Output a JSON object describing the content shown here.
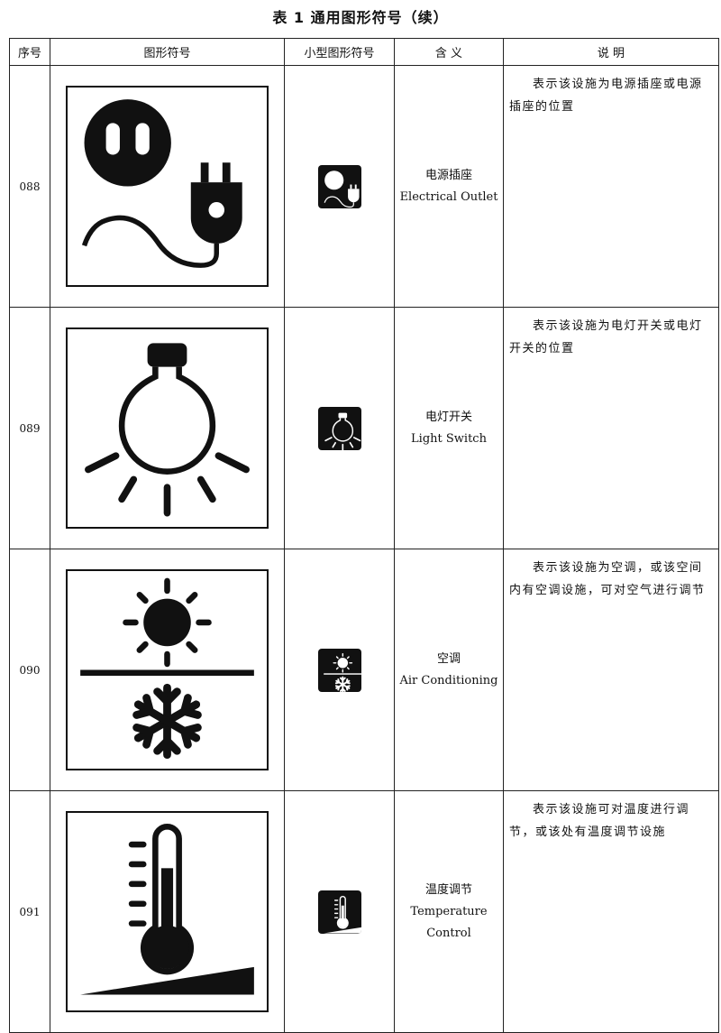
{
  "title": "表 1  通用图形符号（续）",
  "headers": [
    "序号",
    "图形符号",
    "小型图形符号",
    "含  义",
    "说  明"
  ],
  "rows": [
    {
      "no": "088",
      "icon": "electrical-outlet-icon",
      "zh": "电源插座",
      "en": "Electrical Outlet",
      "desc": "表示该设施为电源插座或电源插座的位置"
    },
    {
      "no": "089",
      "icon": "light-bulb-icon",
      "zh": "电灯开关",
      "en": "Light Switch",
      "desc": "表示该设施为电灯开关或电灯开关的位置"
    },
    {
      "no": "090",
      "icon": "air-conditioning-icon",
      "zh": "空调",
      "en": "Air Conditioning",
      "desc": "表示该设施为空调，或该空间内有空调设施，可对空气进行调节"
    },
    {
      "no": "091",
      "icon": "thermometer-icon",
      "zh": "温度调节",
      "en": "Temperature Control",
      "desc": "表示该设施可对温度进行调节，或该处有温度调节设施"
    }
  ]
}
